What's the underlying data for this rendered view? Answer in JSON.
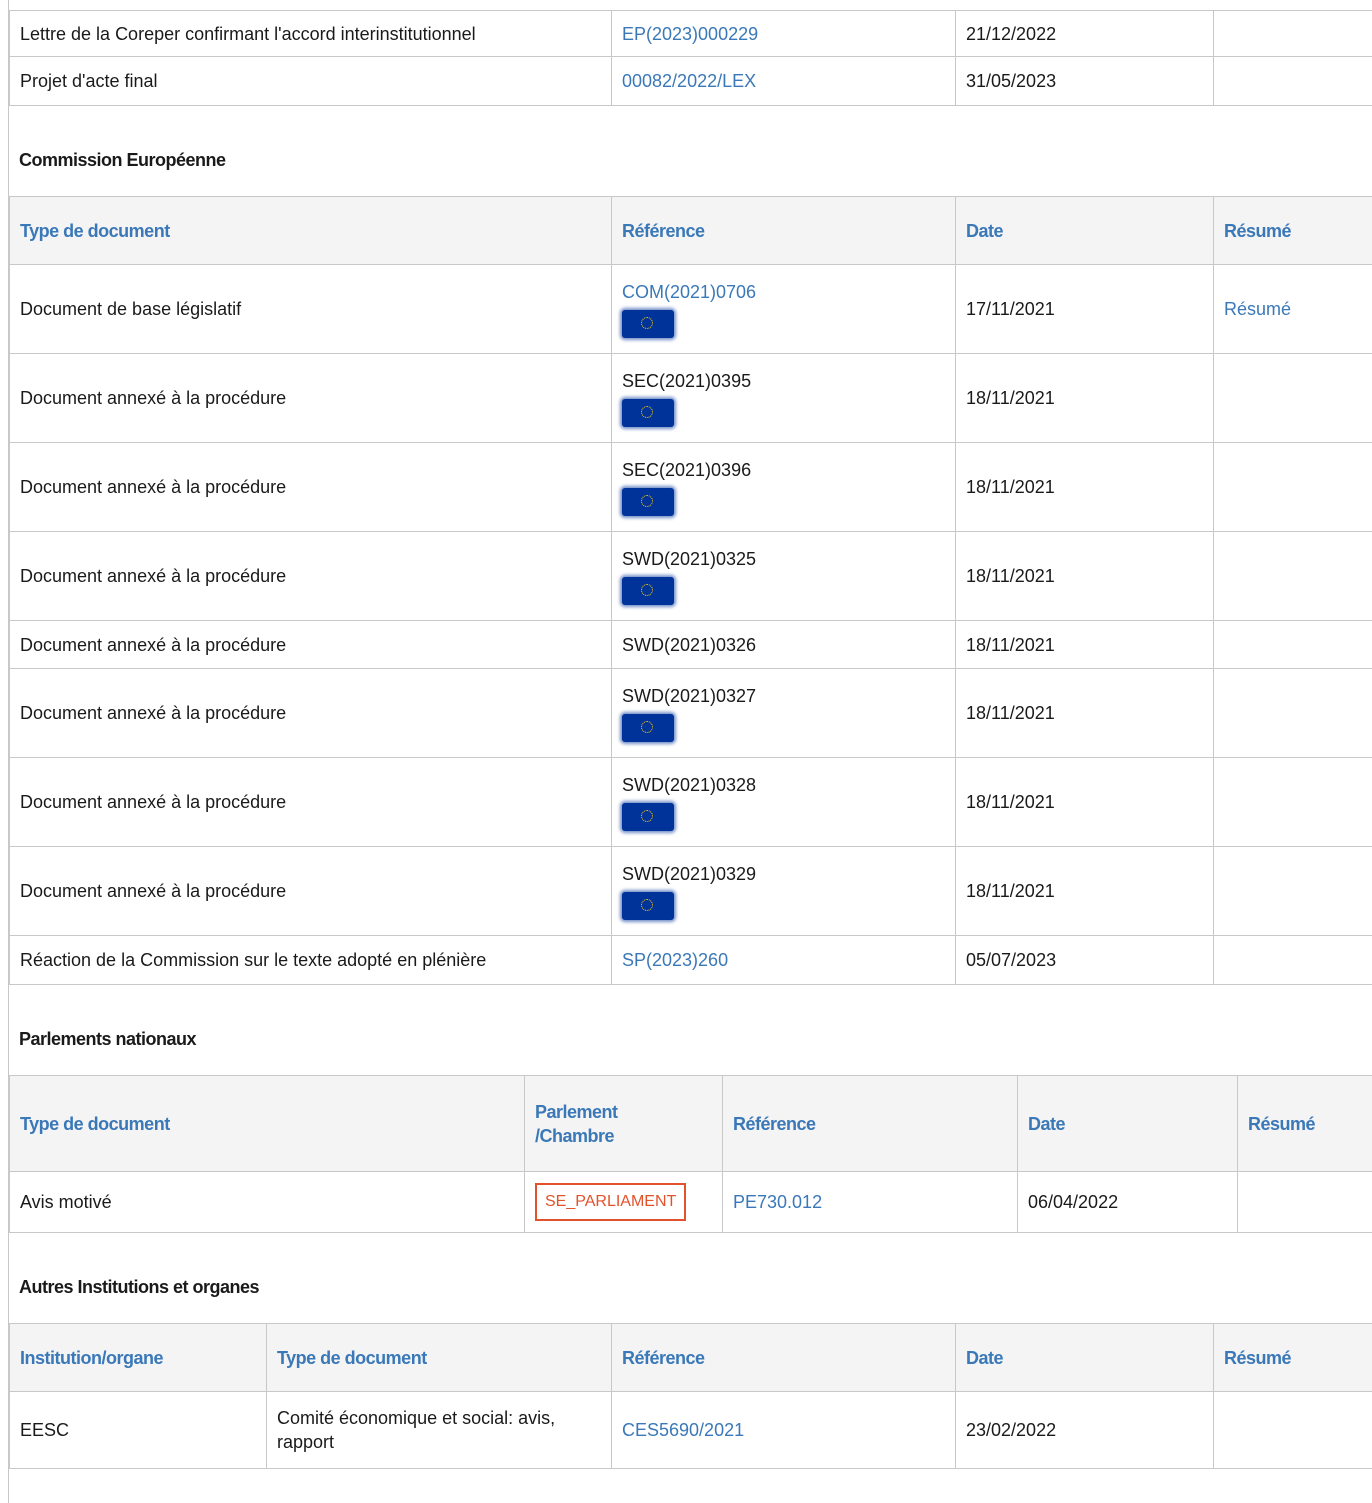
{
  "council": {
    "rows": [
      {
        "type": "Lettre de la Coreper confirmant l'accord interinstitutionnel",
        "ref": "EP(2023)000229",
        "date": "21/12/2022",
        "summary": ""
      },
      {
        "type": "Projet d'acte final",
        "ref": "00082/2022/LEX",
        "date": "31/05/2023",
        "summary": ""
      }
    ]
  },
  "commission": {
    "title": "Commission Européenne",
    "headers": {
      "type": "Type de document",
      "ref": "Référence",
      "date": "Date",
      "summary": "Résumé"
    },
    "rows": [
      {
        "type": "Document de base législatif",
        "ref": "COM(2021)0706",
        "date": "17/11/2021",
        "summary": "Résumé"
      },
      {
        "type": "Document annexé à la procédure",
        "ref": "SEC(2021)0395",
        "date": "18/11/2021"
      },
      {
        "type": "Document annexé à la procédure",
        "ref": "SEC(2021)0396",
        "date": "18/11/2021"
      },
      {
        "type": "Document annexé à la procédure",
        "ref": "SWD(2021)0325",
        "date": "18/11/2021"
      },
      {
        "type": "Document annexé à la procédure",
        "ref": "SWD(2021)0326",
        "date": "18/11/2021"
      },
      {
        "type": "Document annexé à la procédure",
        "ref": "SWD(2021)0327",
        "date": "18/11/2021"
      },
      {
        "type": "Document annexé à la procédure",
        "ref": "SWD(2021)0328",
        "date": "18/11/2021"
      },
      {
        "type": "Document annexé à la procédure",
        "ref": "SWD(2021)0329",
        "date": "18/11/2021"
      },
      {
        "type": "Réaction de la Commission sur le texte adopté en plénière",
        "ref": "SP(2023)260",
        "date": "05/07/2023"
      }
    ]
  },
  "national": {
    "title": "Parlements nationaux",
    "headers": {
      "type": "Type de document",
      "chamber_line1": "Parlement",
      "chamber_line2": "/Chambre",
      "ref": "Référence",
      "date": "Date",
      "summary": "Résumé"
    },
    "rows": [
      {
        "type": "Avis motivé",
        "chamber": "SE_PARLIAMENT",
        "ref": "PE730.012",
        "date": "06/04/2022"
      }
    ]
  },
  "other": {
    "title": "Autres Institutions et organes",
    "headers": {
      "institution": "Institution/organe",
      "type": "Type de document",
      "ref": "Référence",
      "date": "Date",
      "summary": "Résumé"
    },
    "rows": [
      {
        "institution": "EESC",
        "type_line1": "Comité économique et social: avis,",
        "type_line2": "rapport",
        "ref": "CES5690/2021",
        "date": "23/02/2022"
      }
    ]
  },
  "icons": {
    "eu_flag": "eu-flag-icon"
  },
  "colors": {
    "link": "#3a78b8",
    "badge": "#e2522c",
    "flag": "#003399",
    "header_bg": "#f4f4f4"
  }
}
